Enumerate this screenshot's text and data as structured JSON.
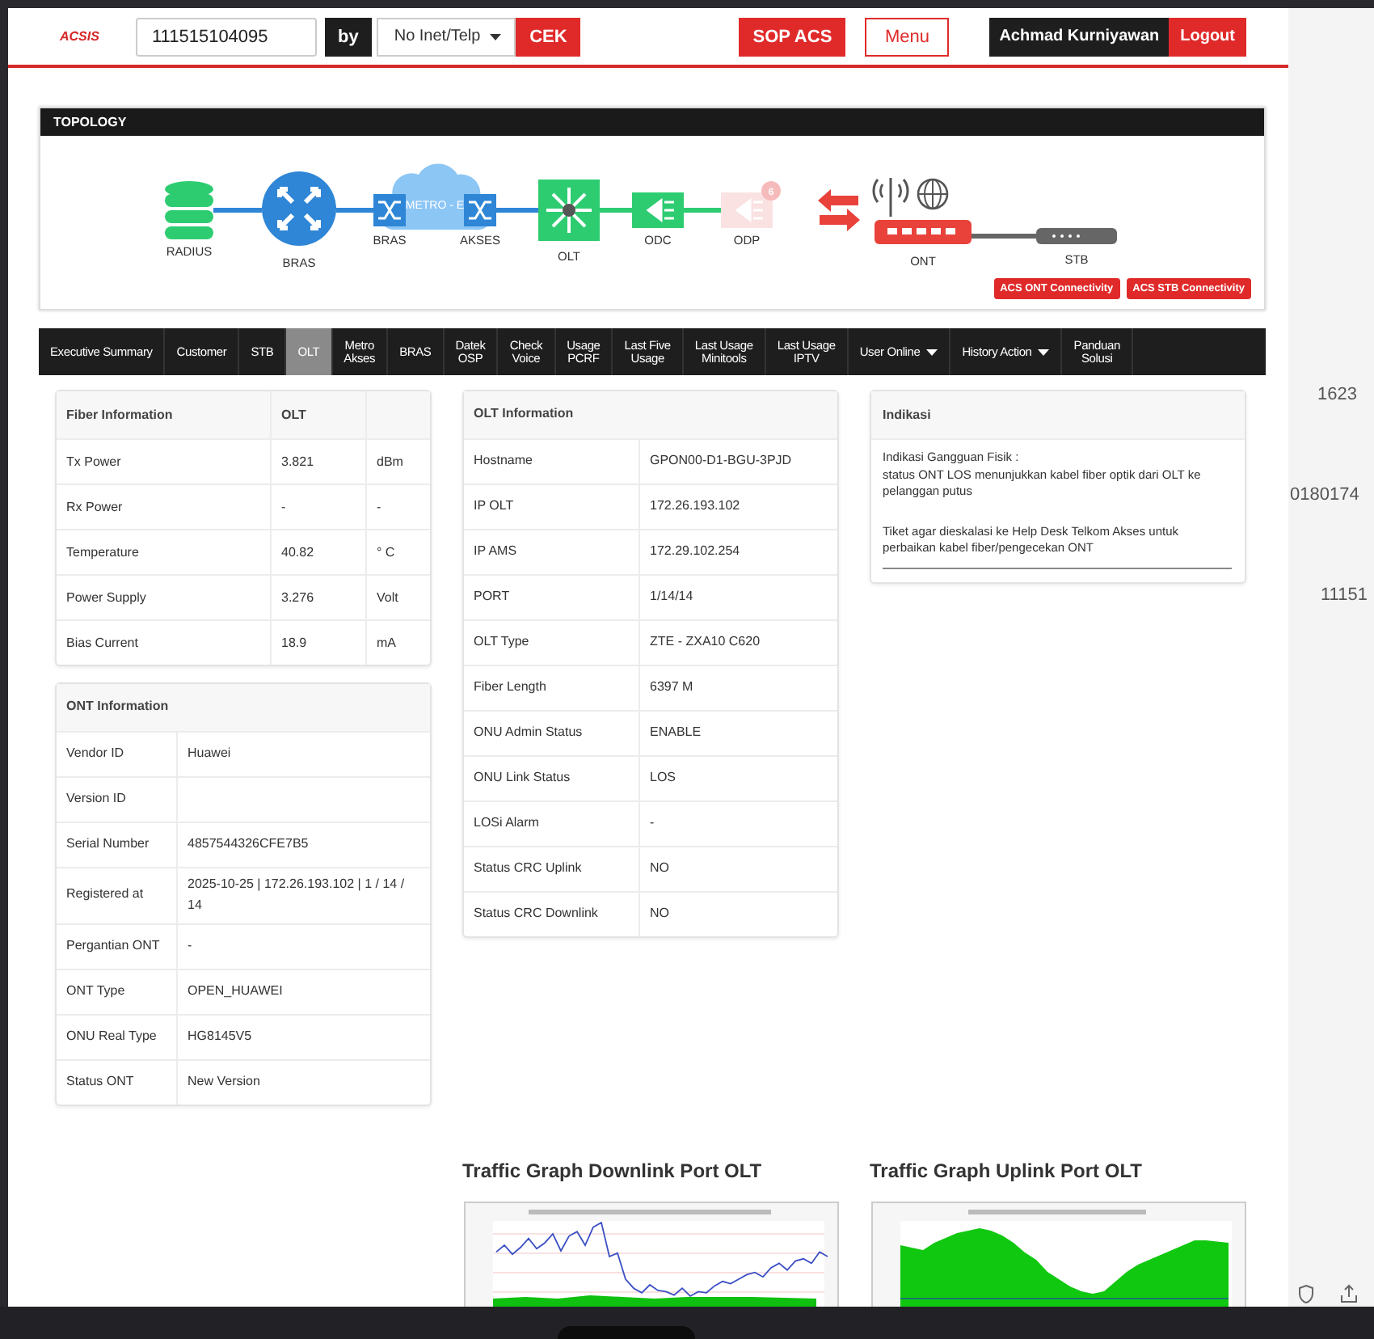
{
  "header": {
    "logo": "ACSIS",
    "search_value": "111515104095",
    "by_label": "by",
    "search_type": "No Inet/Telp",
    "check_button": "CEK",
    "sop_button": "SOP ACS",
    "menu_button": "Menu",
    "user_name": "Achmad Kurniyawan",
    "logout_button": "Logout"
  },
  "topology": {
    "title": "TOPOLOGY",
    "nodes": [
      {
        "label": "RADIUS",
        "kind": "database",
        "active": true
      },
      {
        "label": "BRAS",
        "kind": "router",
        "active": true
      },
      {
        "label": "BRAS",
        "kind": "switch",
        "active": true
      },
      {
        "label": "METRO - E",
        "kind": "cloud",
        "active": true
      },
      {
        "label": "AKSES",
        "kind": "switch",
        "active": true
      },
      {
        "label": "OLT",
        "kind": "olt",
        "active": true
      },
      {
        "label": "ODC",
        "kind": "splitter",
        "active": true
      },
      {
        "label": "ODP",
        "kind": "splitter",
        "active": false,
        "alarm_count": "6"
      },
      {
        "label": "ONT",
        "kind": "ont",
        "active": true
      },
      {
        "label": "STB",
        "kind": "stb",
        "active": true
      }
    ],
    "buttons": [
      "ACS ONT Connectivity",
      "ACS STB Connectivity"
    ]
  },
  "tabs": [
    {
      "label": "Executive Summary",
      "selected": false,
      "has_menu": false
    },
    {
      "label": "Customer",
      "selected": false,
      "has_menu": false
    },
    {
      "label": "STB",
      "selected": false,
      "has_menu": false
    },
    {
      "label": "OLT",
      "selected": true,
      "has_menu": false
    },
    {
      "label": "Metro\nAkses",
      "selected": false,
      "has_menu": false
    },
    {
      "label": "BRAS",
      "selected": false,
      "has_menu": false
    },
    {
      "label": "Datek\nOSP",
      "selected": false,
      "has_menu": false
    },
    {
      "label": "Check\nVoice",
      "selected": false,
      "has_menu": false
    },
    {
      "label": "Usage\nPCRF",
      "selected": false,
      "has_menu": false
    },
    {
      "label": "Last Five\nUsage",
      "selected": false,
      "has_menu": false
    },
    {
      "label": "Last Usage\nMinitools",
      "selected": false,
      "has_menu": false
    },
    {
      "label": "Last Usage\nIPTV",
      "selected": false,
      "has_menu": false
    },
    {
      "label": "User Online",
      "selected": false,
      "has_menu": true
    },
    {
      "label": "History Action",
      "selected": false,
      "has_menu": true
    },
    {
      "label": "Panduan\nSolusi",
      "selected": false,
      "has_menu": false
    }
  ],
  "fiber_information": {
    "columns": [
      "Fiber Information",
      "OLT"
    ],
    "rows": [
      [
        "Tx Power",
        "3.821",
        "dBm"
      ],
      [
        "Rx Power",
        "-",
        "-"
      ],
      [
        "Temperature",
        "40.82",
        "° C"
      ],
      [
        "Power Supply",
        "3.276",
        "Volt"
      ],
      [
        "Bias Current",
        "18.9",
        "mA"
      ]
    ]
  },
  "ont_information": {
    "title": "ONT Information",
    "rows": [
      [
        "Vendor ID",
        "Huawei"
      ],
      [
        "Version ID",
        ""
      ],
      [
        "Serial Number",
        "4857544326CFE7B5"
      ],
      [
        "Registered at",
        "2025-10-25 | 172.26.193.102 | 1 / 14 / 14"
      ],
      [
        "Pergantian ONT",
        "-"
      ],
      [
        "ONT Type",
        "OPEN_HUAWEI"
      ],
      [
        "ONU Real Type",
        "HG8145V5"
      ],
      [
        "Status ONT",
        "New Version"
      ]
    ]
  },
  "olt_information": {
    "title": "OLT Information",
    "rows": [
      [
        "Hostname",
        "GPON00-D1-BGU-3PJD"
      ],
      [
        "IP OLT",
        "172.26.193.102"
      ],
      [
        "IP AMS",
        "172.29.102.254"
      ],
      [
        "PORT",
        "1/14/14"
      ],
      [
        "OLT Type",
        "ZTE - ZXA10 C620"
      ],
      [
        "Fiber Length",
        "6397 M"
      ],
      [
        "ONU Admin Status",
        "ENABLE"
      ],
      [
        "ONU Link Status",
        "LOS"
      ],
      [
        "LOSi Alarm",
        "-"
      ],
      [
        "Status CRC Uplink",
        "NO"
      ],
      [
        "Status CRC Downlink",
        "NO"
      ]
    ]
  },
  "indikasi": {
    "title": "Indikasi",
    "paragraphs": [
      [
        "Indikasi Gangguan Fisik :",
        "status ONT LOS menunjukkan kabel fiber optik dari OLT ke pelanggan putus"
      ],
      [
        "Tiket agar dieskalasi ke Help Desk Telkom Akses untuk perbaikan kabel fiber/pengecekan ONT"
      ]
    ]
  },
  "graphs": [
    {
      "title": "Traffic Graph Downlink Port OLT",
      "kind": "downlink"
    },
    {
      "title": "Traffic Graph Uplink Port OLT",
      "kind": "uplink"
    }
  ],
  "background_page": {
    "fragments": [
      "1623",
      "0180174",
      "11151"
    ]
  }
}
